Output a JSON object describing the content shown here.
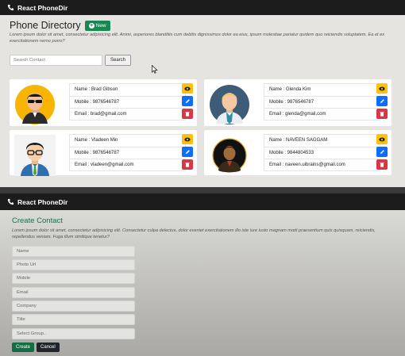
{
  "top_nav": {
    "brand": "React PhoneDir"
  },
  "directory": {
    "title": "Phone Directory",
    "new_button": "New",
    "description": "Lorem ipsum dolor sit amet, consectetur adipisicing elit. Animi, asperiores blanditiis cum debitis dignissimos dolor ea eius, ipsum molestiae pariatur quidem quo reiciendis voluptatem. Ea et ex exercitationem nemo porro?",
    "search_placeholder": "Search Contact",
    "search_button": "Search",
    "contacts": [
      {
        "name": "Name : Brad Gibson",
        "mobile": "Mobile : 9876546787",
        "email": "Email : brad@gmail.com",
        "avatar_icon": "avatar-sunglasses-icon"
      },
      {
        "name": "Name : Glenda Kim",
        "mobile": "Mobile : 9876546787",
        "email": "Email : glenda@gmail.com",
        "avatar_icon": "avatar-businessman-icon"
      },
      {
        "name": "Name : Vladeen Min",
        "mobile": "Mobile : 9876546787",
        "email": "Email : vladeen@gmail.com",
        "avatar_icon": "avatar-glasses-icon"
      },
      {
        "name": "Name : NAVEEN SAGGAM",
        "mobile": "Mobile : 9844804533",
        "email": "Email : naveen.uibrains@gmail.com",
        "avatar_icon": "avatar-photo-icon"
      }
    ]
  },
  "bottom_nav": {
    "brand": "React PhoneDir"
  },
  "create_form": {
    "title": "Create Contact",
    "description": "Lorem ipsum dolor sit amet, consectetur adipisicing elit. Consectetur culpa delectus, dolor eveniet exercitationem illo iste iure iusto magnam modi praesentium quis quisquam, reiciendis, repellendus veniam. Fuga illum similique tenetur?",
    "fields": {
      "name": "Name",
      "photo_url": "Photo Url",
      "mobile": "Mobile",
      "email": "Email",
      "company": "Company",
      "title": "Title",
      "group": "Select Group.."
    },
    "create_button": "Create",
    "cancel_button": "Cancel"
  },
  "colors": {
    "navbar": "#1c1c1c",
    "new_green": "#198754",
    "view": "#ffc107",
    "edit": "#0d6efd",
    "delete": "#dc3545",
    "form_title": "#1f6b4c"
  }
}
